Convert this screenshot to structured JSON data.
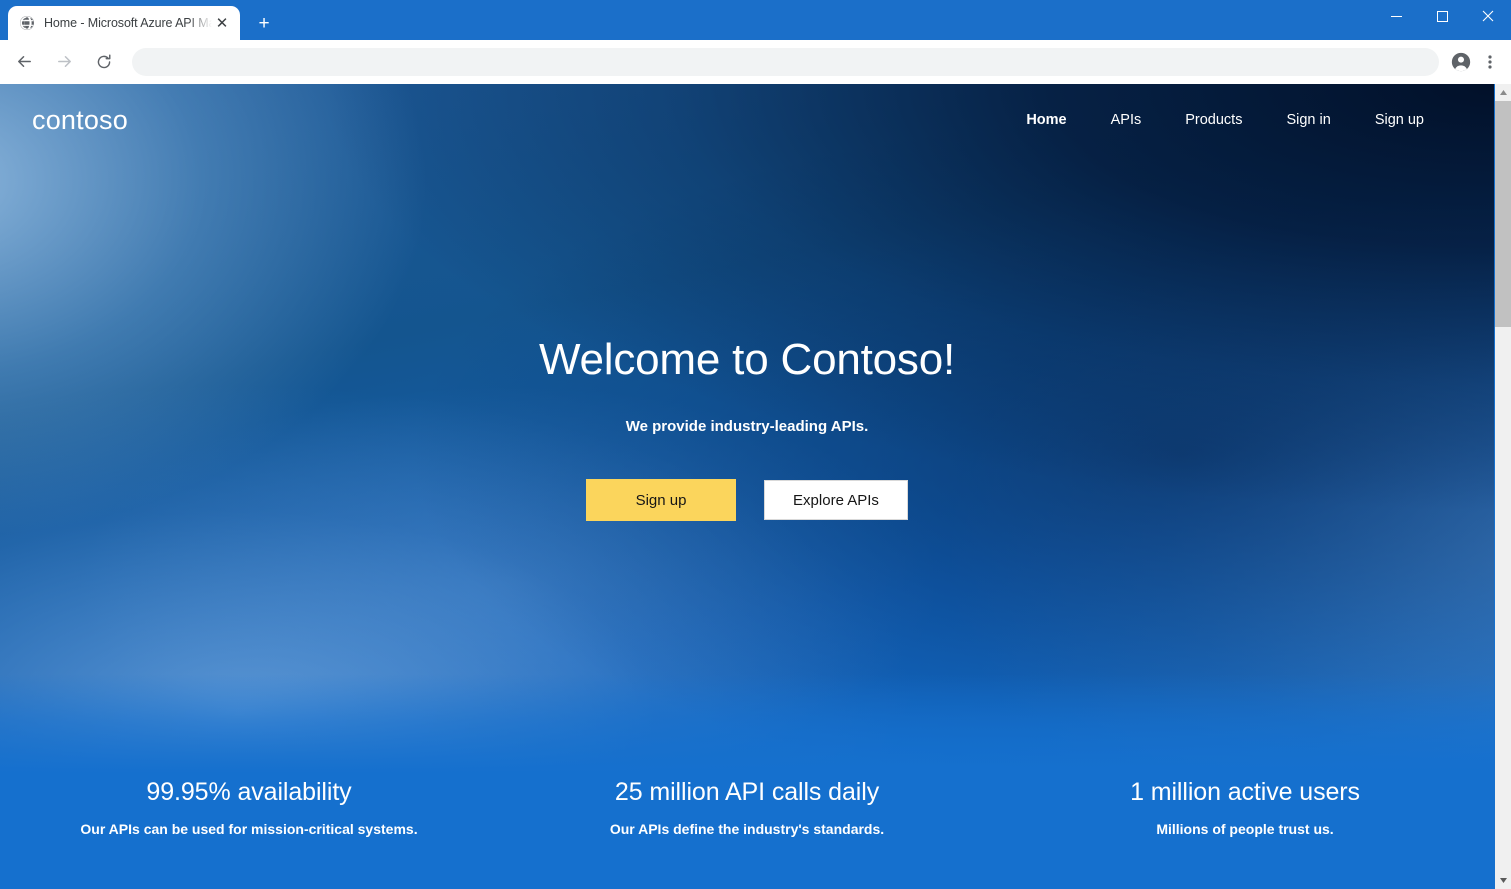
{
  "browser": {
    "tab": {
      "title": "Home - Microsoft Azure API Man",
      "favicon_name": "globe-icon",
      "close_label": "✕"
    },
    "new_tab_label": "+",
    "window_controls": {
      "minimize": "minimize-icon",
      "maximize": "maximize-icon",
      "close": "close-icon"
    },
    "toolbar": {
      "back": "back-arrow-icon",
      "forward": "forward-arrow-icon",
      "reload": "reload-icon",
      "address_value": "",
      "address_placeholder": "",
      "profile": "profile-icon",
      "menu": "kebab-menu-icon"
    },
    "scrollbar": {
      "up_arrow": "▲",
      "down_arrow": "▼"
    }
  },
  "site": {
    "logo": "contoso",
    "nav": [
      {
        "label": "Home",
        "active": true
      },
      {
        "label": "APIs",
        "active": false
      },
      {
        "label": "Products",
        "active": false
      },
      {
        "label": "Sign in",
        "active": false
      },
      {
        "label": "Sign up",
        "active": false
      }
    ]
  },
  "hero": {
    "title": "Welcome to Contoso!",
    "subtitle": "We provide industry-leading APIs.",
    "primary_button": "Sign up",
    "secondary_button": "Explore APIs"
  },
  "stats": [
    {
      "value": "99.95% availability",
      "desc": "Our APIs can be used for mission-critical systems."
    },
    {
      "value": "25 million API calls daily",
      "desc": "Our APIs define the industry's standards."
    },
    {
      "value": "1 million active users",
      "desc": "Millions of people trust us."
    }
  ],
  "colors": {
    "brand_blue": "#1570ce",
    "chrome_blue": "#1b6fc9",
    "accent_yellow": "#fbd55c",
    "dark_navy": "#021432"
  }
}
